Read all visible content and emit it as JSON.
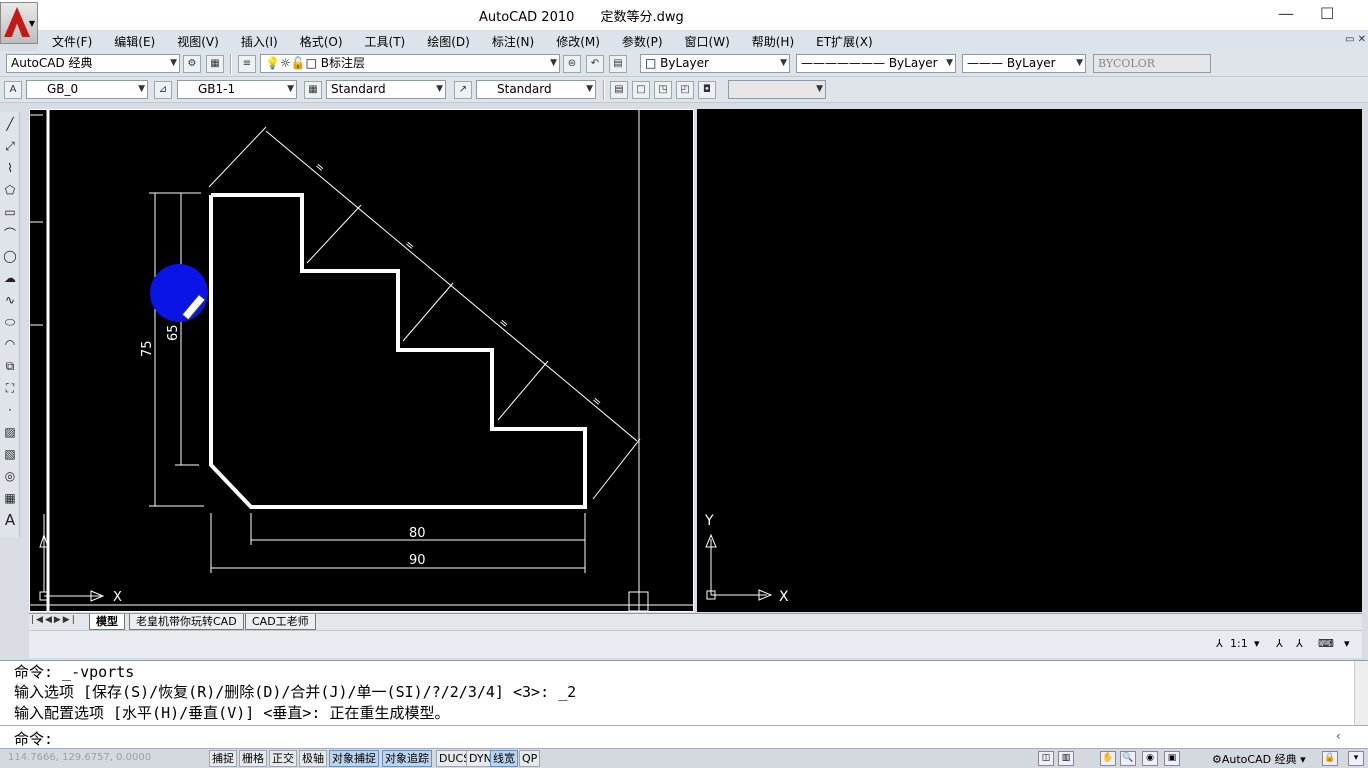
{
  "window": {
    "app_title": "AutoCAD 2010",
    "file_name": "定数等分.dwg",
    "minimize_glyph": "—",
    "maximize_glyph": "☐"
  },
  "menu": [
    "文件(F)",
    "编辑(E)",
    "视图(V)",
    "插入(I)",
    "格式(O)",
    "工具(T)",
    "绘图(D)",
    "标注(N)",
    "修改(M)",
    "参数(P)",
    "窗口(W)",
    "帮助(H)",
    "ET扩展(X)"
  ],
  "toolbar1": {
    "workspace": "AutoCAD 经典",
    "layer": "B标注层",
    "color": "ByLayer",
    "linetype": "ByLayer",
    "lineweight": "ByLayer",
    "plotstyle": "BYCOLOR"
  },
  "toolbar2": {
    "text_style": "GB_0",
    "dim_style": "GB1-1",
    "table_style": "Standard",
    "multileader_style": "Standard",
    "empty_combo": ""
  },
  "drawing": {
    "dim_overall_height": "75",
    "dim_inner_height": "65",
    "dim_inner_width": "80",
    "dim_overall_width": "90",
    "equal_mark": "=",
    "axis_x": "X",
    "axis_y": "Y"
  },
  "colors": {
    "canvas": "#000000",
    "geometry": "#ffffff",
    "cursor_highlight": "#0a14e6"
  },
  "tabs": {
    "model": "模型",
    "layout1": "老皇机带你玩转CAD",
    "layout2": "CAD工老师"
  },
  "annotation_scale": "1:1",
  "command": {
    "history": [
      "命令:  _-vports",
      "输入选项 [保存(S)/恢复(R)/删除(D)/合并(J)/单一(SI)/?/2/3/4] <3>: _2",
      "输入配置选项 [水平(H)/垂直(V)] <垂直>:  正在重生成模型。"
    ],
    "prompt": "命令:"
  },
  "status": {
    "coordinates": "114.7666, 129.6757, 0.0000",
    "toggles": [
      {
        "label": "捕捉",
        "on": false
      },
      {
        "label": "栅格",
        "on": false
      },
      {
        "label": "正交",
        "on": false
      },
      {
        "label": "极轴",
        "on": false
      },
      {
        "label": "对象捕捉",
        "on": true
      },
      {
        "label": "对象追踪",
        "on": true
      },
      {
        "label": "DUCS",
        "on": false
      },
      {
        "label": "DYN",
        "on": false
      },
      {
        "label": "线宽",
        "on": true
      },
      {
        "label": "QP",
        "on": false
      }
    ],
    "workspace": "AutoCAD 经典"
  }
}
